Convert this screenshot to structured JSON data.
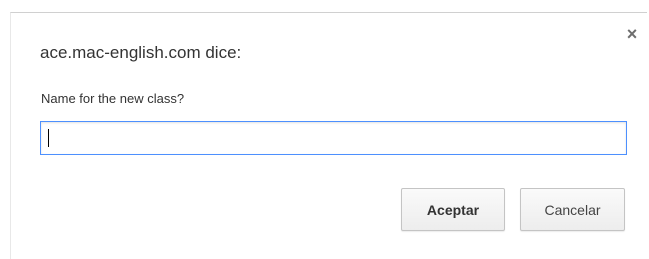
{
  "dialog": {
    "title": "ace.mac-english.com dice:",
    "message": "Name for the new class?",
    "input_value": "",
    "close_glyph": "×",
    "buttons": {
      "ok_label": "Aceptar",
      "cancel_label": "Cancelar"
    }
  },
  "colors": {
    "input_focus_border": "#4d90fe",
    "text": "#333333"
  }
}
